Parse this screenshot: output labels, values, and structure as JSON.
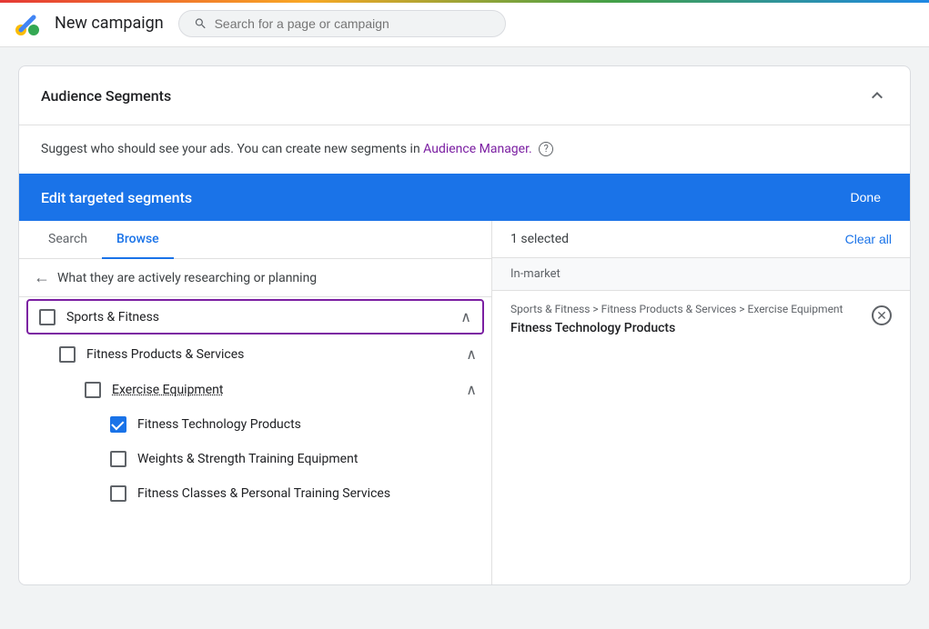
{
  "topbar": {
    "title": "New campaign",
    "search_placeholder": "Search for a page or campaign"
  },
  "card": {
    "header": "Audience Segments",
    "suggest_text": "Suggest who should see your ads.  You can create new segments in ",
    "audience_manager_link": "Audience Manager.",
    "edit_bar_title": "Edit targeted segments",
    "done_label": "Done"
  },
  "tabs": {
    "search_label": "Search",
    "browse_label": "Browse",
    "active": "Browse"
  },
  "back_nav": {
    "label": "What they are actively researching or planning"
  },
  "tree": [
    {
      "id": "sports-fitness",
      "label": "Sports & Fitness",
      "level": 1,
      "highlighted": true,
      "checked": false,
      "expanded": true,
      "children": [
        {
          "id": "fitness-products",
          "label": "Fitness Products & Services",
          "level": 2,
          "checked": false,
          "expanded": true,
          "children": [
            {
              "id": "exercise-equipment",
              "label": "Exercise Equipment",
              "level": 3,
              "checked": false,
              "underlined": true,
              "expanded": true,
              "children": [
                {
                  "id": "fitness-technology",
                  "label": "Fitness Technology Products",
                  "level": 4,
                  "checked": true
                },
                {
                  "id": "weights-strength",
                  "label": "Weights & Strength Training Equipment",
                  "level": 4,
                  "checked": false
                },
                {
                  "id": "fitness-classes",
                  "label": "Fitness Classes & Personal Training Services",
                  "level": 4,
                  "checked": false
                }
              ]
            }
          ]
        }
      ]
    }
  ],
  "right_panel": {
    "selected_count": "1 selected",
    "clear_all_label": "Clear all",
    "in_market_label": "In-market",
    "selected_items": [
      {
        "breadcrumb": "Sports & Fitness > Fitness Products & Services > Exercise Equipment",
        "name": "Fitness Technology Products"
      }
    ]
  }
}
